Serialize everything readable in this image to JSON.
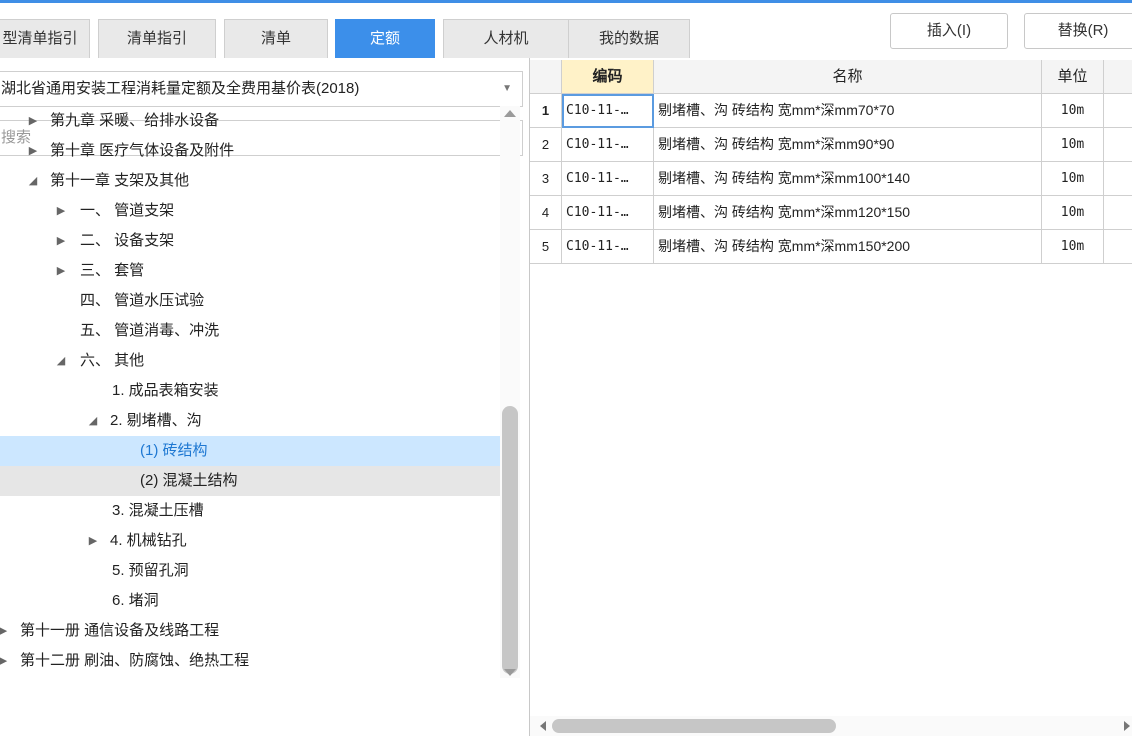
{
  "tabs": [
    {
      "label": "型清单指引"
    },
    {
      "label": "清单指引"
    },
    {
      "label": "清单"
    },
    {
      "label": "定额"
    },
    {
      "label": "人材机"
    },
    {
      "label": "我的数据"
    }
  ],
  "toolbar": {
    "insert_label": "插入(I)",
    "replace_label": "替换(R)"
  },
  "library": {
    "selected": "湖北省通用安装工程消耗量定额及全费用基价表(2018)"
  },
  "search": {
    "placeholder": "搜索"
  },
  "tree": [
    {
      "label": "第九章 采暖、给排水设备",
      "state": "collapsed"
    },
    {
      "label": "第十章 医疗气体设备及附件",
      "state": "collapsed"
    },
    {
      "label": "第十一章 支架及其他",
      "state": "expanded"
    },
    {
      "label": "一、 管道支架",
      "state": "collapsed"
    },
    {
      "label": "二、 设备支架",
      "state": "collapsed"
    },
    {
      "label": "三、 套管",
      "state": "collapsed"
    },
    {
      "label": "四、 管道水压试验",
      "state": "leaf"
    },
    {
      "label": "五、 管道消毒、冲洗",
      "state": "leaf"
    },
    {
      "label": "六、 其他",
      "state": "expanded"
    },
    {
      "label": "1. 成品表箱安装",
      "state": "leaf"
    },
    {
      "label": "2. 剔堵槽、沟",
      "state": "expanded"
    },
    {
      "label": "(1) 砖结构",
      "state": "selected"
    },
    {
      "label": "(2) 混凝土结构",
      "state": "leaf"
    },
    {
      "label": "3. 混凝土压槽",
      "state": "leaf"
    },
    {
      "label": "4. 机械钻孔",
      "state": "collapsed"
    },
    {
      "label": "5. 预留孔洞",
      "state": "leaf"
    },
    {
      "label": "6. 堵洞",
      "state": "leaf"
    },
    {
      "label": "第十一册 通信设备及线路工程",
      "state": "collapsed"
    },
    {
      "label": "第十二册 刷油、防腐蚀、绝热工程",
      "state": "collapsed"
    }
  ],
  "grid": {
    "headers": {
      "code": "编码",
      "name": "名称",
      "unit": "单位"
    },
    "rows": [
      {
        "num": "1",
        "code": "C10-11-…",
        "name": "剔堵槽、沟 砖结构 宽mm*深mm70*70",
        "unit": "10m"
      },
      {
        "num": "2",
        "code": "C10-11-…",
        "name": "剔堵槽、沟 砖结构 宽mm*深mm90*90",
        "unit": "10m"
      },
      {
        "num": "3",
        "code": "C10-11-…",
        "name": "剔堵槽、沟 砖结构 宽mm*深mm100*140",
        "unit": "10m"
      },
      {
        "num": "4",
        "code": "C10-11-…",
        "name": "剔堵槽、沟 砖结构 宽mm*深mm120*150",
        "unit": "10m"
      },
      {
        "num": "5",
        "code": "C10-11-…",
        "name": "剔堵槽、沟 砖结构 宽mm*深mm150*200",
        "unit": "10m"
      }
    ]
  },
  "colors": {
    "accent": "#3c8fea",
    "selection": "#cce7ff",
    "code_header": "#fff2c8"
  }
}
